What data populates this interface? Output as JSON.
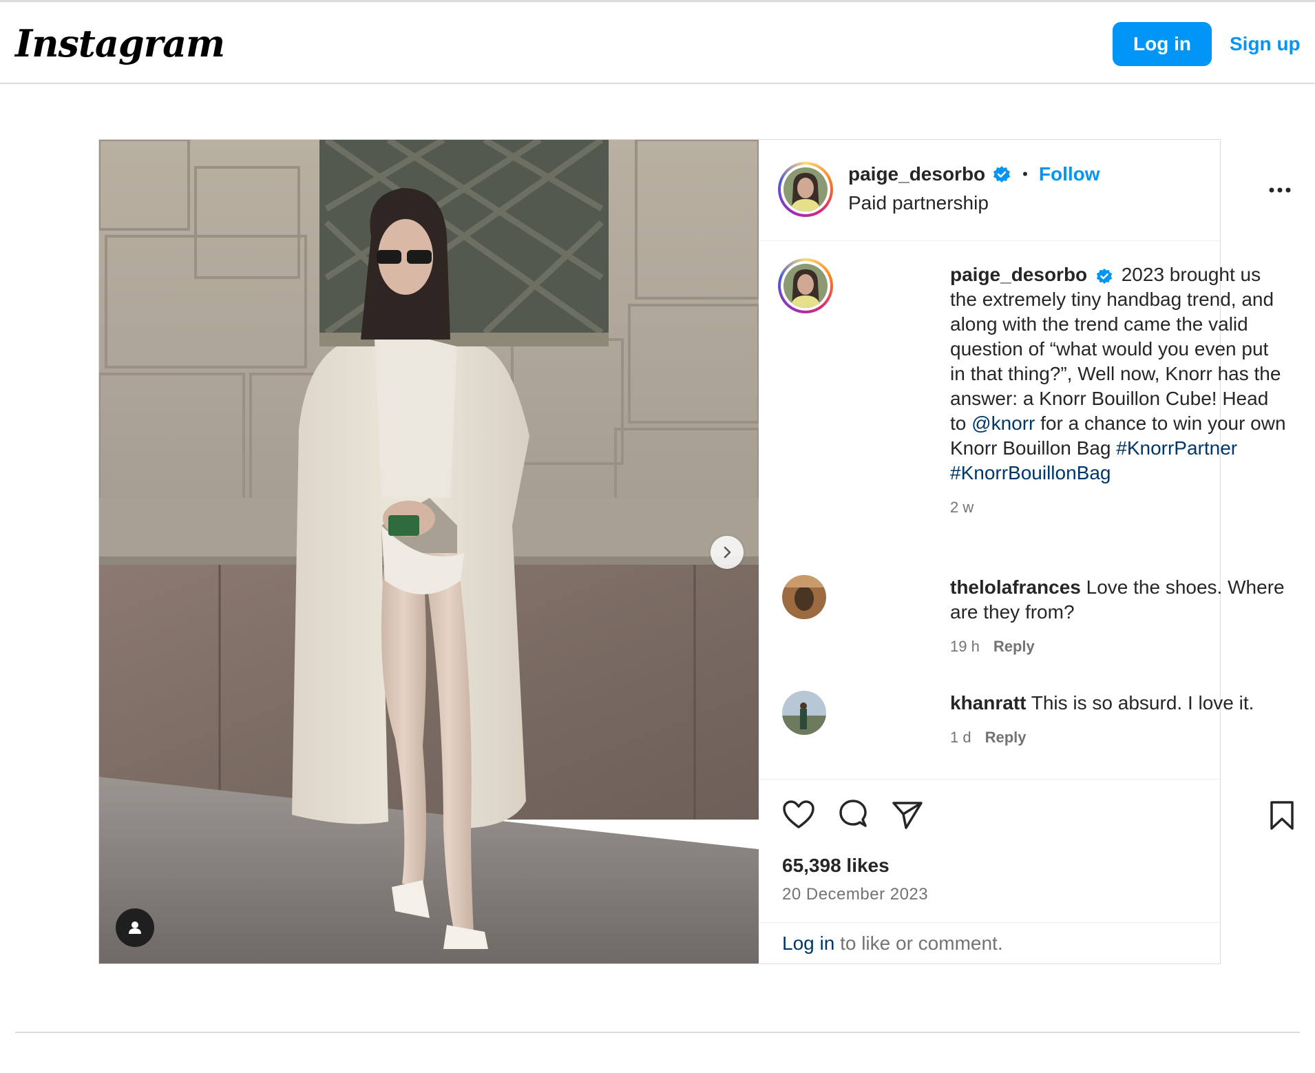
{
  "nav": {
    "logo": "Instagram",
    "login_label": "Log in",
    "signup_label": "Sign up"
  },
  "post": {
    "username": "paige_desorbo",
    "follow_label": "Follow",
    "separator": "•",
    "paid_label": "Paid partnership",
    "caption_parts": {
      "p1": "2023 brought us the extremely tiny handbag trend, and along with the trend came the valid question of “what would you even put in that thing?”, Well now, Knorr has the answer: a Knorr Bouillon Cube! Head to ",
      "mention": "@knorr",
      "p2": " for a chance to win your own Knorr Bouillon Bag ",
      "tag1": "#KnorrPartner",
      "tag2": "#KnorrBouillonBag"
    },
    "caption_time": "2 w",
    "comments": [
      {
        "user": "thelolafrances",
        "text": "Love the shoes. Where are they from?",
        "time": "19 h",
        "reply": "Reply"
      },
      {
        "user": "khanratt",
        "text": "This is so absurd. I love it.",
        "time": "1 d",
        "reply": "Reply"
      }
    ],
    "likes": "65,398 likes",
    "date": "20 December 2023",
    "login_link": "Log in",
    "login_suffix": " to like or comment."
  },
  "icons": {
    "like": "heart-icon",
    "comment": "comment-icon",
    "share": "share-icon",
    "save": "bookmark-icon",
    "more": "more-options-icon",
    "verified": "verified-badge-icon",
    "next": "chevron-right-icon",
    "tagged": "user-tag-icon"
  },
  "colors": {
    "accent": "#0095f6",
    "link": "#00376b",
    "secondary_text": "#737373"
  }
}
